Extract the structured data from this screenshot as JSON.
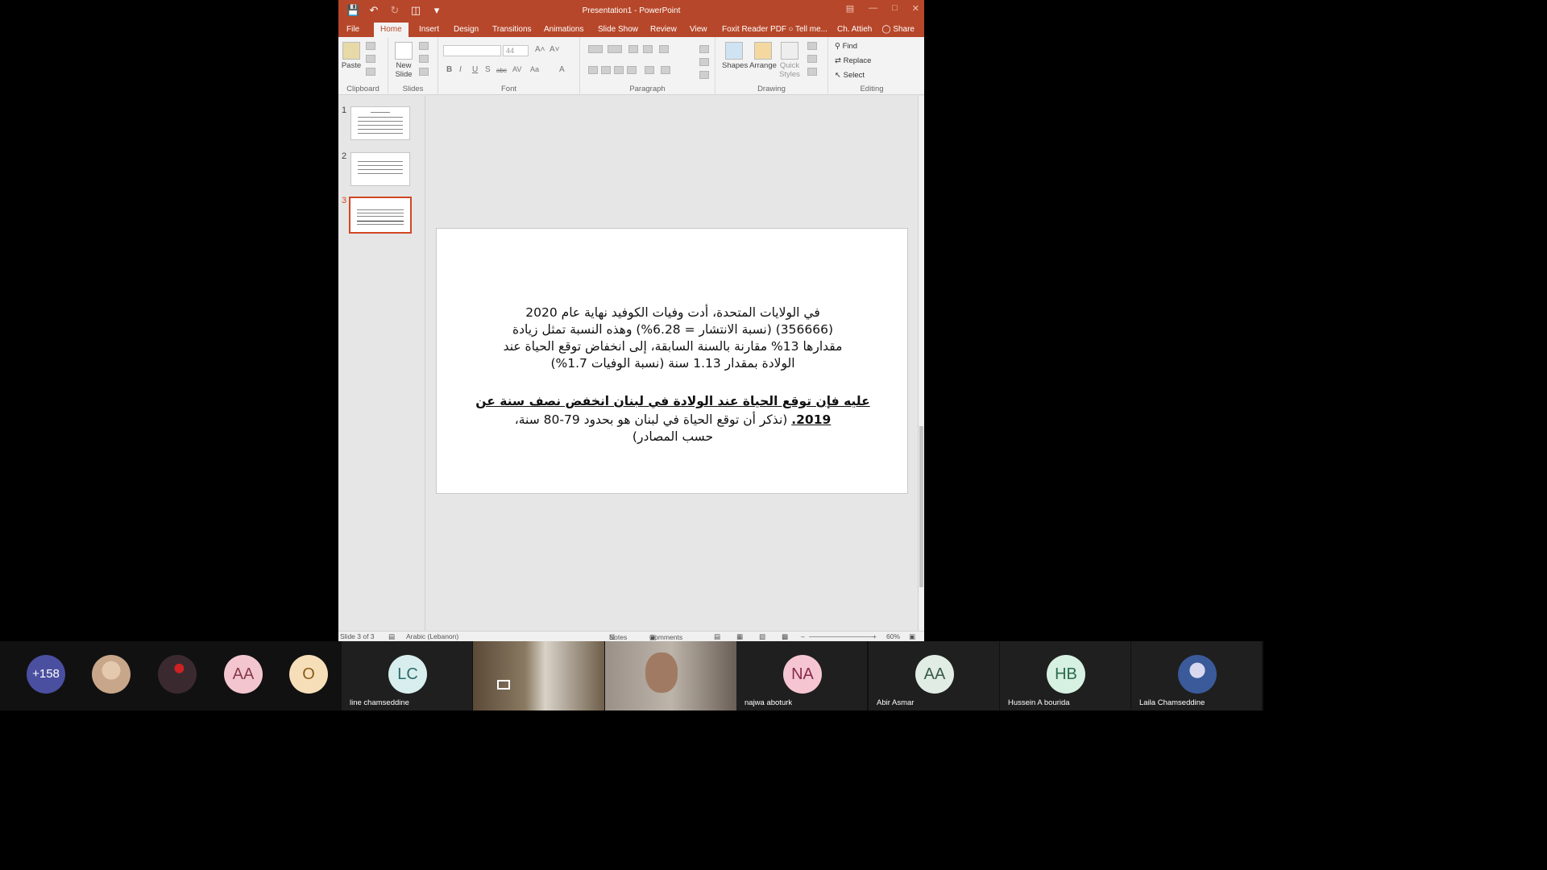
{
  "window": {
    "title": "Presentation1 - PowerPoint",
    "quick_access": [
      "save-icon",
      "undo-icon",
      "redo-icon",
      "present-icon",
      "customize-icon"
    ]
  },
  "ribbon": {
    "tabs": [
      "File",
      "Home",
      "Insert",
      "Design",
      "Transitions",
      "Animations",
      "Slide Show",
      "Review",
      "View",
      "Foxit Reader PDF"
    ],
    "active_tab": "Home",
    "tell_me": "Tell me...",
    "user": "Ch. Attieh",
    "share": "Share",
    "clipboard": {
      "paste": "Paste",
      "label": "Clipboard"
    },
    "slides": {
      "new_slide": "New Slide",
      "label": "Slides"
    },
    "font": {
      "size": "44",
      "label": "Font",
      "buttons": [
        "B",
        "I",
        "U",
        "S",
        "abc",
        "AV",
        "Aa",
        "A"
      ]
    },
    "paragraph": {
      "label": "Paragraph"
    },
    "drawing": {
      "shapes": "Shapes",
      "arrange": "Arrange",
      "quick_styles": "Quick Styles",
      "label": "Drawing"
    },
    "editing": {
      "find": "Find",
      "replace": "Replace",
      "select": "Select",
      "label": "Editing"
    }
  },
  "thumbnails": [
    {
      "number": "1"
    },
    {
      "number": "2"
    },
    {
      "number": "3",
      "selected": true
    }
  ],
  "slide": {
    "lines": [
      "في الولايات المتحدة، أدت وفيات الكوفيد نهاية عام 2020",
      "(356666) (نسبة الانتشار = 6.28%) وهذه النسبة تمثل زيادة",
      "مقدارها 13% مقارنة بالسنة السابقة، إلى انخفاض توقع الحياة عند",
      "الولادة بمقدار 1.13 سنة (نسبة الوفيات 1.7%)"
    ],
    "bold_line": "عليه فإن توقع الحياة عند الولادة في لبنان انخفض نصف سنة عن",
    "bold_year": "2019.",
    "tail_line": " (نذكر أن توقع الحياة في لبنان هو بحدود 79-80 سنة،",
    "last_line": "حسب المصادر)"
  },
  "statusbar": {
    "slide": "Slide 3 of 3",
    "language": "Arabic (Lebanon)",
    "notes": "Notes",
    "comments": "Comments",
    "zoom": "60%"
  },
  "participants": [
    {
      "kind": "count",
      "label": "+158",
      "color": "#4a4fa0"
    },
    {
      "kind": "photo",
      "color": "#c8a68a"
    },
    {
      "kind": "photo",
      "color": "#3a2a30"
    },
    {
      "kind": "initials",
      "label": "AA",
      "color": "#f3c6cf",
      "text_color": "#8a3a4a"
    },
    {
      "kind": "initials",
      "label": "O",
      "color": "#f6dfb8",
      "text_color": "#8a5a1a"
    },
    {
      "kind": "initials",
      "label": "LC",
      "color": "#d8eeee",
      "text_color": "#2a6a6a",
      "name": "line chamseddine"
    },
    {
      "kind": "video",
      "color": "#6e5e4a"
    },
    {
      "kind": "video",
      "color": "#8a8078"
    },
    {
      "kind": "initials",
      "label": "NA",
      "color": "#f5c6d2",
      "text_color": "#8a2a4a",
      "name": "najwa aboturk"
    },
    {
      "kind": "initials",
      "label": "AA",
      "color": "#e0ece4",
      "text_color": "#3a5a4a",
      "name": "Abir Asmar"
    },
    {
      "kind": "initials",
      "label": "HB",
      "color": "#d6f0e2",
      "text_color": "#2a6a4a",
      "name": "Hussein A bourida"
    },
    {
      "kind": "photo",
      "color": "#3a5a9a",
      "name": "Laila Chamseddine"
    }
  ]
}
